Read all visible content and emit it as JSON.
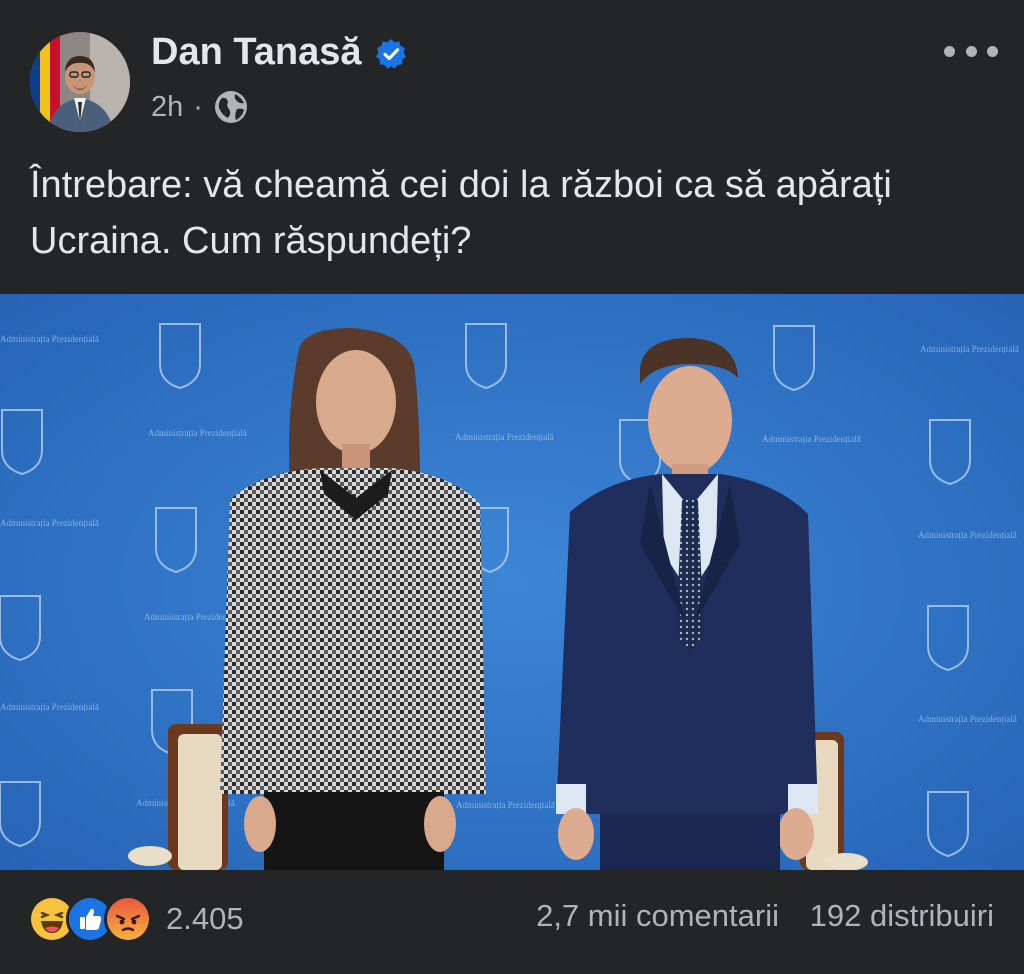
{
  "post": {
    "author": "Dan Tanasă",
    "time": "2h",
    "separator": "·",
    "visibility_icon": "globe-icon",
    "verified_icon": "verified-badge-icon",
    "more_icon": "more-options-icon",
    "text": "Întrebare: vă cheamă cei doi la război ca să apărați Ucraina. Cum răspundeți?"
  },
  "photo": {
    "backdrop_text": "Administrația Prezidențială"
  },
  "footer": {
    "reaction_icons": [
      "haha-reaction-icon",
      "like-reaction-icon",
      "angry-reaction-icon"
    ],
    "reaction_count": "2.405",
    "comments": "2,7 mii comentarii",
    "shares": "192 distribuiri"
  },
  "colors": {
    "background": "#242526",
    "text_primary": "#e4e6eb",
    "text_secondary": "#b0b3b8",
    "verified_blue": "#1b74e4",
    "photo_blue": "#2f70c4"
  }
}
